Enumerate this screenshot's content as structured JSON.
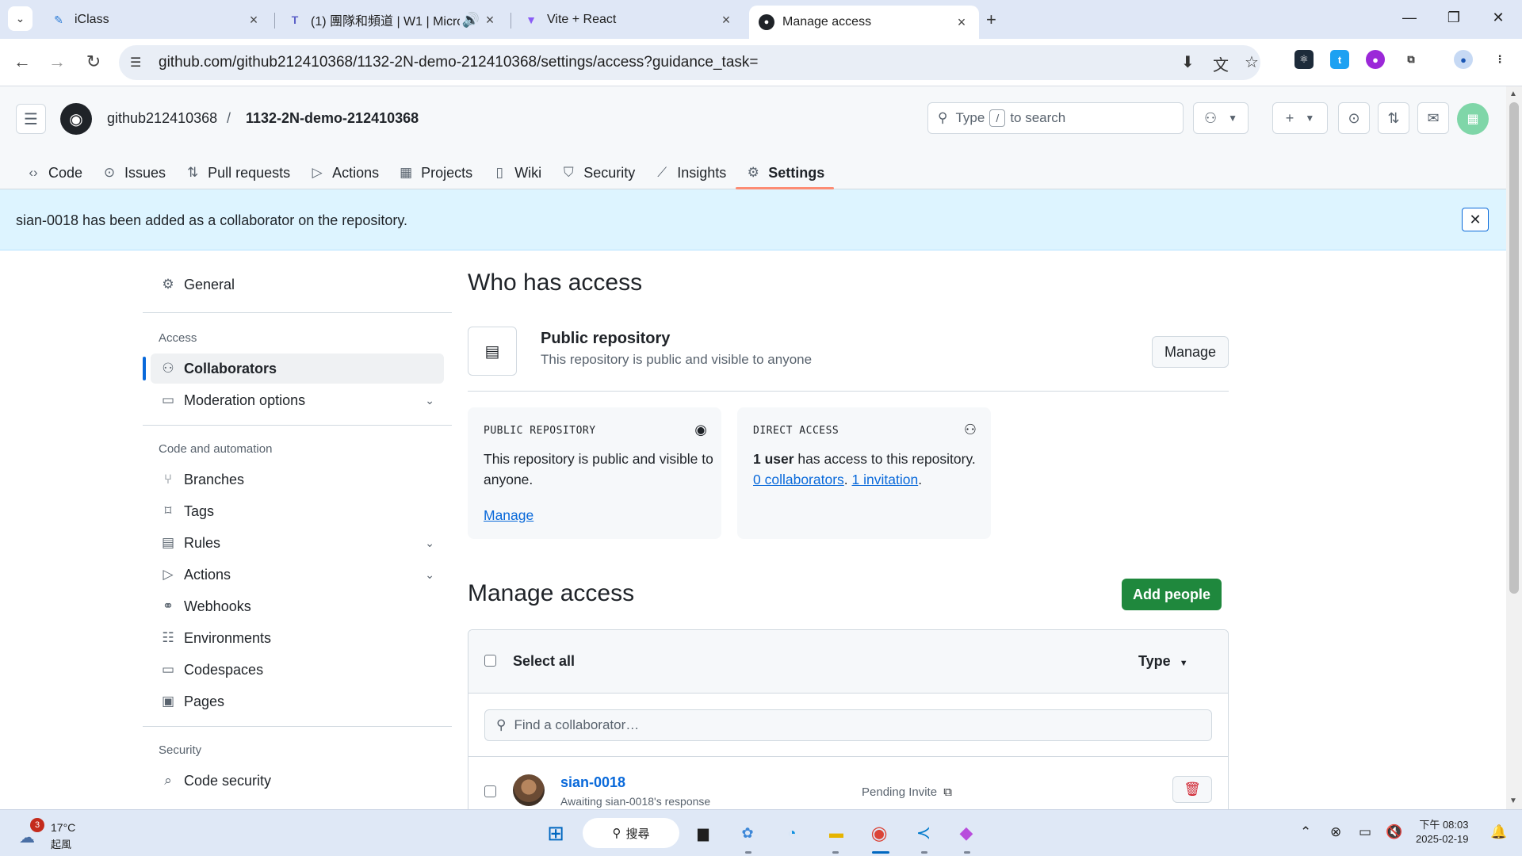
{
  "browser": {
    "tabs": [
      {
        "title": "iClass",
        "favicon": "iclass-icon"
      },
      {
        "title": "(1) 團隊和頻道 | W1 | Micro",
        "favicon": "teams-icon"
      },
      {
        "title": "Vite + React",
        "favicon": "vite-icon"
      },
      {
        "title": "Manage access",
        "favicon": "github-icon"
      }
    ],
    "url": "github.com/github212410368/1132-2N-demo-212410368/settings/access?guidance_task="
  },
  "header": {
    "owner": "github212410368",
    "separator": "/",
    "repo": "1132-2N-demo-212410368",
    "search_prefix": "Type",
    "search_key": "/",
    "search_suffix": "to search"
  },
  "repo_nav": [
    {
      "label": "Code",
      "icon": "code-icon"
    },
    {
      "label": "Issues",
      "icon": "issue-icon"
    },
    {
      "label": "Pull requests",
      "icon": "pull-request-icon"
    },
    {
      "label": "Actions",
      "icon": "play-icon"
    },
    {
      "label": "Projects",
      "icon": "table-icon"
    },
    {
      "label": "Wiki",
      "icon": "book-icon"
    },
    {
      "label": "Security",
      "icon": "shield-icon"
    },
    {
      "label": "Insights",
      "icon": "graph-icon"
    },
    {
      "label": "Settings",
      "icon": "gear-icon"
    }
  ],
  "flash": {
    "message": "sian-0018 has been added as a collaborator on the repository."
  },
  "sidebar": {
    "general": "General",
    "access_heading": "Access",
    "collaborators": "Collaborators",
    "moderation": "Moderation options",
    "code_heading": "Code and automation",
    "branches": "Branches",
    "tags": "Tags",
    "rules": "Rules",
    "actions": "Actions",
    "webhooks": "Webhooks",
    "environments": "Environments",
    "codespaces": "Codespaces",
    "pages": "Pages",
    "security_heading": "Security",
    "code_security": "Code security"
  },
  "main": {
    "who_title": "Who has access",
    "public_title": "Public repository",
    "public_sub": "This repository is public and visible to anyone",
    "manage_label": "Manage",
    "card_public": {
      "label": "PUBLIC REPOSITORY",
      "text": "This repository is public and visible to anyone.",
      "link": "Manage"
    },
    "card_direct": {
      "label": "DIRECT ACCESS",
      "count": "1 user",
      "text_after": " has access to this repository.",
      "collab_link": "0 collaborators",
      "sep": ". ",
      "invite_link": "1 invitation",
      "end": "."
    },
    "manage_title": "Manage access",
    "add_people": "Add people",
    "select_all": "Select all",
    "type_label": "Type",
    "find_placeholder": "Find a collaborator…",
    "row": {
      "name": "sian-0018",
      "sub": "Awaiting sian-0018's response",
      "status": "Pending Invite"
    }
  },
  "taskbar": {
    "notif_count": "3",
    "temp": "17°C",
    "weather_desc": "起風",
    "search": "搜尋",
    "time": "下午 08:03",
    "date": "2025-02-19"
  },
  "colors": {
    "accent_green": "#1f883d",
    "link_blue": "#0969da",
    "flash_bg": "#ddf4ff",
    "selected_underline": "#fd8c73"
  }
}
